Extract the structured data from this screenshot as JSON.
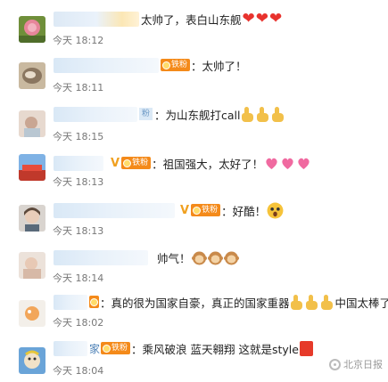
{
  "comments": [
    {
      "text": "太帅了，表白山东舰",
      "time": "今天 18:12",
      "trail": "hearts",
      "trail_count": 3,
      "badge": "",
      "vmark": "",
      "name_text": ""
    },
    {
      "text": "：太帅了！",
      "time": "今天 18:11",
      "trail": "none",
      "trail_count": 0,
      "badge": "铁粉",
      "vmark": "",
      "name_text": ""
    },
    {
      "text": "：为山东舰打call",
      "time": "今天 18:15",
      "trail": "thumbs",
      "trail_count": 3,
      "badge": "",
      "vmark": "",
      "name_text": "粉"
    },
    {
      "text": "：祖国强大，太好了！",
      "time": "今天 18:13",
      "trail": "pinkhearts",
      "trail_count": 3,
      "badge": "铁粉",
      "vmark": "V",
      "name_text": ""
    },
    {
      "text": "：好酷！",
      "time": "今天 18:13",
      "trail": "face",
      "trail_count": 1,
      "badge": "铁粉",
      "vmark": "V",
      "name_text": ""
    },
    {
      "text": "帅气！",
      "time": "今天 18:14",
      "trail": "monkeys",
      "trail_count": 3,
      "badge": "",
      "vmark": "",
      "name_text": ""
    },
    {
      "text": "：真的很为国家自豪，真正的国家重器",
      "text_after": "中国太棒了!",
      "time": "今天 18:02",
      "trail": "thumbs",
      "trail_count": 3,
      "badge": "",
      "vmark": "",
      "name_text": ""
    },
    {
      "text": "：乘风破浪 蓝天翱翔 这就是style",
      "time": "今天 18:04",
      "trail": "red",
      "trail_count": 1,
      "badge": "铁粉",
      "vmark": "",
      "name_text": "家"
    }
  ],
  "watermark": "北京日报",
  "colors": {
    "badge": "#f48a1a",
    "time": "#777777",
    "name_blur": "#d9e8f6",
    "heart": "#e8322d",
    "pink_heart": "#f06aa0"
  }
}
